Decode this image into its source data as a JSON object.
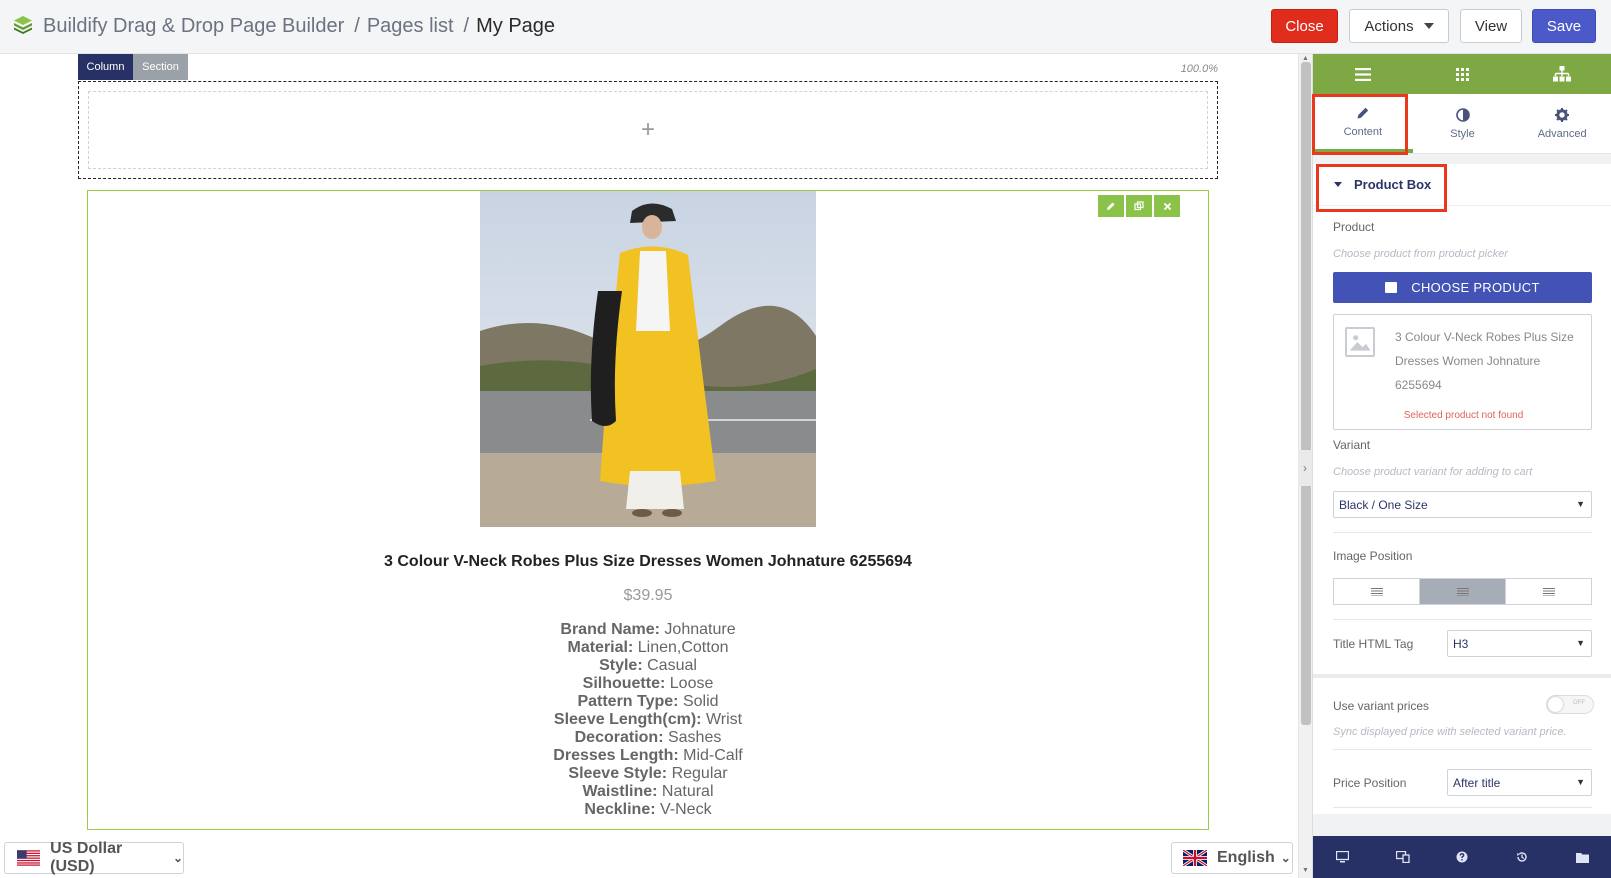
{
  "header": {
    "app_title": "Buildify Drag & Drop Page Builder",
    "breadcrumb_sep1": "/",
    "breadcrumb_pages": "Pages list",
    "breadcrumb_sep2": "/",
    "breadcrumb_current": "My Page",
    "close_label": "Close",
    "actions_label": "Actions",
    "view_label": "View",
    "save_label": "Save"
  },
  "canvas": {
    "tab_column": "Column",
    "tab_section": "Section",
    "zoom": "100.0%",
    "add_symbol": "+",
    "product": {
      "title": "3 Colour V-Neck Robes Plus Size Dresses Women Johnature 6255694",
      "price": "$39.95",
      "specs": [
        {
          "key": "Brand Name:",
          "value": "Johnature"
        },
        {
          "key": "Material:",
          "value": "Linen,Cotton"
        },
        {
          "key": "Style:",
          "value": "Casual"
        },
        {
          "key": "Silhouette:",
          "value": "Loose"
        },
        {
          "key": "Pattern Type:",
          "value": "Solid"
        },
        {
          "key": "Sleeve Length(cm):",
          "value": "Wrist"
        },
        {
          "key": "Decoration:",
          "value": "Sashes"
        },
        {
          "key": "Dresses Length:",
          "value": "Mid-Calf"
        },
        {
          "key": "Sleeve Style:",
          "value": "Regular"
        },
        {
          "key": "Waistline:",
          "value": "Natural"
        },
        {
          "key": "Neckline:",
          "value": "V-Neck"
        }
      ]
    }
  },
  "footer": {
    "currency": "US Dollar (USD)",
    "language": "English"
  },
  "panel": {
    "tabs": {
      "content": "Content",
      "style": "Style",
      "advanced": "Advanced"
    },
    "section_title": "Product Box",
    "product_label": "Product",
    "product_hint": "Choose product from product picker",
    "choose_button": "CHOOSE PRODUCT",
    "card_title": "3 Colour V-Neck Robes Plus Size Dresses Women Johnature 6255694",
    "card_error": "Selected product not found",
    "variant_label": "Variant",
    "variant_hint": "Choose product variant for adding to cart",
    "variant_value": "Black / One Size",
    "image_position_label": "Image Position",
    "title_tag_label": "Title HTML Tag",
    "title_tag_value": "H3",
    "variant_prices_label": "Use variant prices",
    "variant_prices_toggle": "OFF",
    "variant_prices_hint": "Sync displayed price with selected variant price.",
    "price_position_label": "Price Position",
    "price_position_value": "After title"
  },
  "colors": {
    "panel_green": "#7ea844",
    "navy": "#283165",
    "save_blue": "#4b5ac8",
    "close_red": "#e02c1c",
    "highlight_red": "#e8391f"
  },
  "icons": [
    "hamburger-icon",
    "grid-icon",
    "sitemap-icon",
    "pencil-icon",
    "contrast-icon",
    "gear-icon",
    "caret-down-icon",
    "shopping-bag-icon",
    "image-placeholder-icon",
    "desktop-icon",
    "responsive-icon",
    "help-icon",
    "history-icon",
    "folder-icon"
  ]
}
